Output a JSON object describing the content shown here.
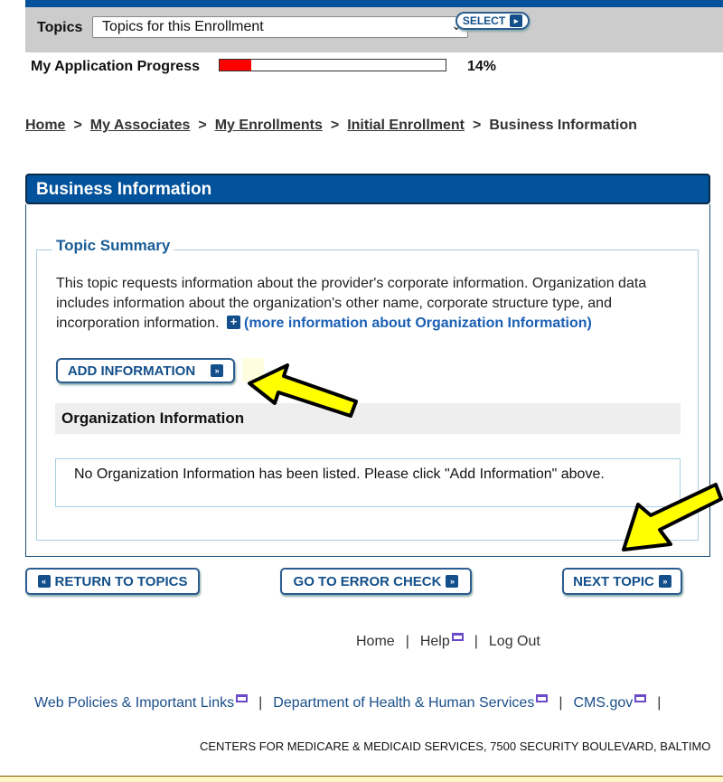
{
  "topics": {
    "label": "Topics",
    "selected": "Topics for this Enrollment",
    "select_button": "SELECT"
  },
  "progress": {
    "label": "My Application Progress",
    "percent_value": 14,
    "percent_text": "14%",
    "fill_color": "#ff0000"
  },
  "breadcrumb": [
    {
      "label": "Home",
      "link": true
    },
    {
      "label": "My Associates",
      "link": true
    },
    {
      "label": "My Enrollments",
      "link": true
    },
    {
      "label": "Initial Enrollment",
      "link": true
    },
    {
      "label": "Business Information",
      "link": false
    }
  ],
  "breadcrumb_separator": ">",
  "panel": {
    "title": "Business Information",
    "topic_summary_label": "Topic Summary",
    "summary_text": "This topic requests information about the provider's corporate information. Organization data includes information about the organization's other name, corporate structure type, and incorporation information.",
    "more_info_link": "(more information about Organization Information)",
    "add_button": "ADD INFORMATION",
    "org_header": "Organization Information",
    "org_empty": "No Organization Information has been listed. Please click \"Add Information\" above."
  },
  "nav_buttons": {
    "return": "RETURN TO TOPICS",
    "error_check": "GO TO ERROR CHECK",
    "next": "NEXT TOPIC"
  },
  "footer": {
    "links": [
      "Home",
      "Help",
      "Log Out"
    ],
    "external_links": [
      "Web Policies & Important Links",
      "Department of Health & Human Services",
      "CMS.gov"
    ],
    "address": "CENTERS FOR MEDICARE & MEDICAID SERVICES, 7500 SECURITY BOULEVARD, BALTIMO"
  },
  "colors": {
    "brand_blue": "#03529c",
    "link_blue": "#1a5fb4",
    "annotation_arrow": "#ffff00"
  },
  "icons": {
    "select": "chevron-right-icon",
    "add": "double-chevron-right-icon",
    "return": "double-chevron-left-icon",
    "plus": "plus-icon",
    "external": "external-window-icon"
  }
}
